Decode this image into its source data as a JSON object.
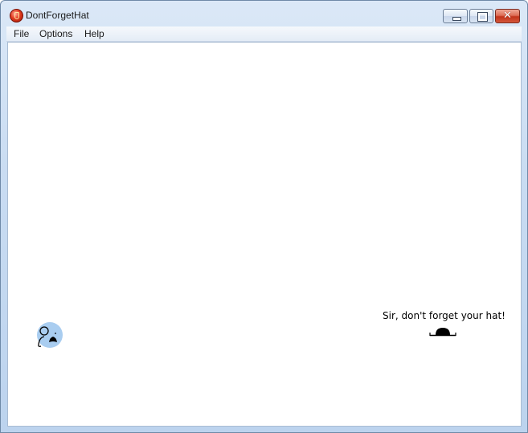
{
  "window": {
    "title": "DontForgetHat",
    "icon": "app-icon",
    "controls": {
      "minimize": "minimize-icon",
      "maximize": "maximize-icon",
      "close": "close-icon",
      "close_glyph": "✕"
    }
  },
  "menu": {
    "items": [
      {
        "label": "File"
      },
      {
        "label": "Options"
      },
      {
        "label": "Help"
      }
    ]
  },
  "scene": {
    "message": "Sir, don't forget your hat!",
    "avatar_icon": "man-with-mustache-icon",
    "hat_icon": "bowler-hat-icon",
    "avatar_color": "#a9cdf0"
  }
}
